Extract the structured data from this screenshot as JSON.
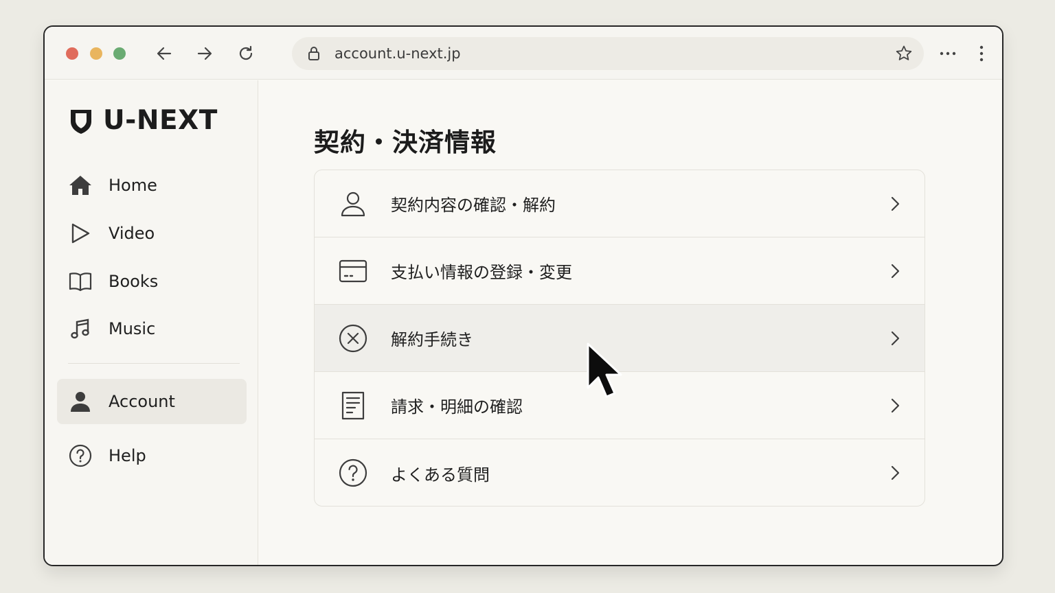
{
  "browser": {
    "url": "account.u-next.jp"
  },
  "brand": {
    "name": "U-NEXT"
  },
  "sidebar": {
    "items": [
      {
        "label": "Home",
        "icon": "home-icon"
      },
      {
        "label": "Video",
        "icon": "play-icon"
      },
      {
        "label": "Books",
        "icon": "book-icon"
      },
      {
        "label": "Music",
        "icon": "music-note-icon"
      },
      {
        "label": "Account",
        "icon": "user-icon",
        "active": true
      },
      {
        "label": "Help",
        "icon": "help-circle-icon"
      }
    ]
  },
  "main": {
    "title": "契約・決済情報",
    "rows": [
      {
        "label": "契約内容の確認・解約",
        "icon": "user-outline-icon"
      },
      {
        "label": "支払い情報の登録・変更",
        "icon": "credit-card-icon"
      },
      {
        "label": "解約手続き",
        "icon": "cancel-circle-icon",
        "hovered": true
      },
      {
        "label": "請求・明細の確認",
        "icon": "receipt-icon"
      },
      {
        "label": "よくある質問",
        "icon": "question-circle-icon"
      }
    ]
  },
  "colors": {
    "background": "#ecebe4",
    "window": "#f9f8f4",
    "text": "#1f1f1f",
    "active_item": "#ebe9e3",
    "traffic_red": "#e06c5c",
    "traffic_yellow": "#e9b55e",
    "traffic_green": "#6aab72"
  }
}
